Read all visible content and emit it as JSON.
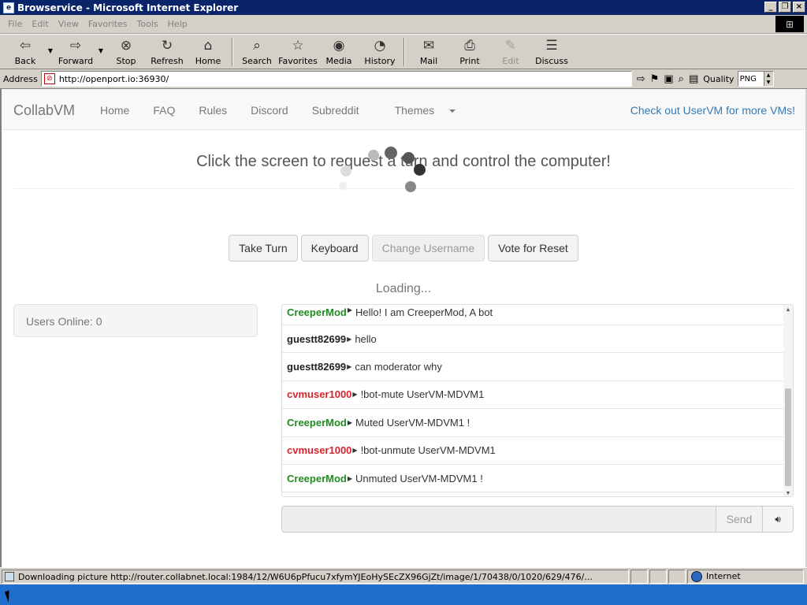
{
  "window": {
    "title": "Browservice - Microsoft Internet Explorer"
  },
  "menu": [
    "File",
    "Edit",
    "View",
    "Favorites",
    "Tools",
    "Help"
  ],
  "toolbar": {
    "back": "Back",
    "forward": "Forward",
    "stop": "Stop",
    "refresh": "Refresh",
    "home": "Home",
    "search": "Search",
    "favorites": "Favorites",
    "media": "Media",
    "history": "History",
    "mail": "Mail",
    "print": "Print",
    "edit": "Edit",
    "discuss": "Discuss"
  },
  "address": {
    "label": "Address",
    "url": "http://openport.io:36930/",
    "quality_label": "Quality",
    "quality_value": "PNG"
  },
  "nav": {
    "brand": "CollabVM",
    "links": [
      "Home",
      "FAQ",
      "Rules",
      "Discord",
      "Subreddit",
      "Themes"
    ],
    "right_link": "Check out UserVM for more VMs!"
  },
  "headline": "Click the screen to request a turn and control the computer!",
  "buttons": {
    "take_turn": "Take Turn",
    "keyboard": "Keyboard",
    "change_username": "Change Username",
    "vote_reset": "Vote for Reset"
  },
  "loading": "Loading...",
  "users_online": "Users Online: 0",
  "chat": [
    {
      "user": "CreeperMod",
      "message": "Hello! I am CreeperMod, A bot",
      "color": "green"
    },
    {
      "user": "guestt82699",
      "message": "hello",
      "color": "black"
    },
    {
      "user": "guestt82699",
      "message": "can moderator why",
      "color": "black"
    },
    {
      "user": "cvmuser1000",
      "message": "!bot-mute UserVM-MDVM1",
      "color": "red"
    },
    {
      "user": "CreeperMod",
      "message": "Muted UserVM-MDVM1 !",
      "color": "green"
    },
    {
      "user": "cvmuser1000",
      "message": "!bot-unmute UserVM-MDVM1",
      "color": "red"
    },
    {
      "user": "CreeperMod",
      "message": "Unmuted UserVM-MDVM1 !",
      "color": "green"
    }
  ],
  "send": "Send",
  "status": {
    "text": "Downloading picture http://router.collabnet.local:1984/12/W6U6pPfucu7xfymYJEoHySEcZX96GjZt/image/1/70438/0/1020/629/476/...",
    "zone": "Internet"
  },
  "colors": {
    "titlebar": "#0a246a",
    "chrome": "#d4d0c8",
    "link": "#337ab7",
    "green_user": "#228b22",
    "red_user": "#d9232d",
    "taskbar": "#1e6fcd"
  }
}
